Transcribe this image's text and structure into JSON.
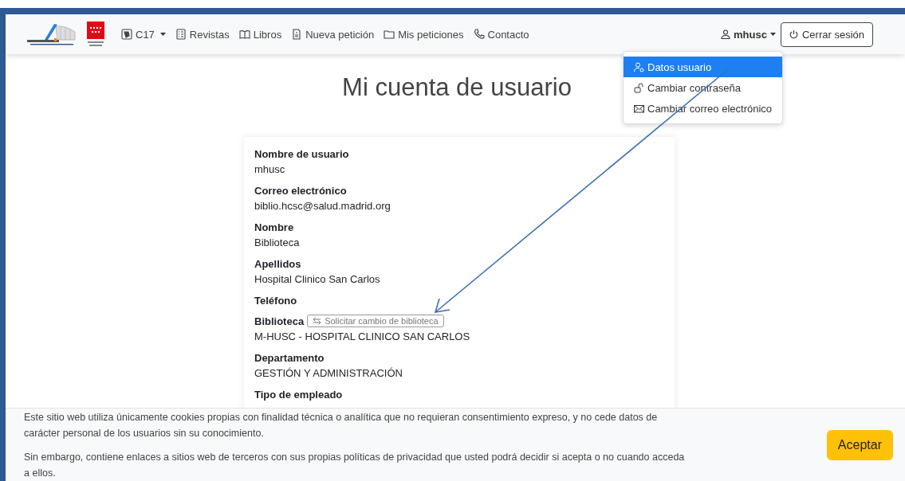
{
  "navbar": {
    "items": [
      {
        "kind": "badge",
        "label": "C17",
        "caret": true
      },
      {
        "kind": "list",
        "label": "Revistas",
        "caret": false
      },
      {
        "kind": "book",
        "label": "Libros",
        "caret": false
      },
      {
        "kind": "file",
        "label": "Nueva petición",
        "caret": false
      },
      {
        "kind": "folder",
        "label": "Mis peticiones",
        "caret": false
      },
      {
        "kind": "phone",
        "label": "Contacto",
        "caret": false
      }
    ],
    "user": {
      "label": "mhusc"
    },
    "logout": {
      "label": "Cerrar sesión"
    }
  },
  "user_menu": [
    {
      "kind": "user",
      "label": "Datos usuario",
      "selected": true
    },
    {
      "kind": "lock",
      "label": "Cambiar contraseña",
      "selected": false
    },
    {
      "kind": "mail",
      "label": "Cambiar correo electrónico",
      "selected": false
    }
  ],
  "title": "Mi cuenta de usuario",
  "fields": [
    {
      "label": "Nombre de usuario",
      "value": "mhusc"
    },
    {
      "label": "Correo electrónico",
      "value": "biblio.hcsc@salud.madrid.org"
    },
    {
      "label": "Nombre",
      "value": "Biblioteca"
    },
    {
      "label": "Apellidos",
      "value": "Hospital Clinico San Carlos"
    },
    {
      "label": "Teléfono"
    },
    {
      "label": "Biblioteca",
      "action": "Solicitar cambio de biblioteca",
      "value": "M-HUSC - HOSPITAL CLINICO SAN CARLOS"
    },
    {
      "label": "Departamento",
      "value": "GESTIÓN Y ADMINISTRACIÓN"
    },
    {
      "label": "Tipo de empleado"
    }
  ],
  "cookie_bar": {
    "paragraphs": [
      "Este sitio web utiliza únicamente cookies propias con finalidad técnica o analítica que no requieran consentimiento expreso, y no cede datos de carácter personal de los usuarios sin su conocimiento.",
      "Sin embargo, contiene enlaces a sitios web de terceros con sus propias políticas de privacidad que usted podrá decidir si acepta o no cuando acceda a ellos."
    ],
    "button": "Aceptar"
  }
}
